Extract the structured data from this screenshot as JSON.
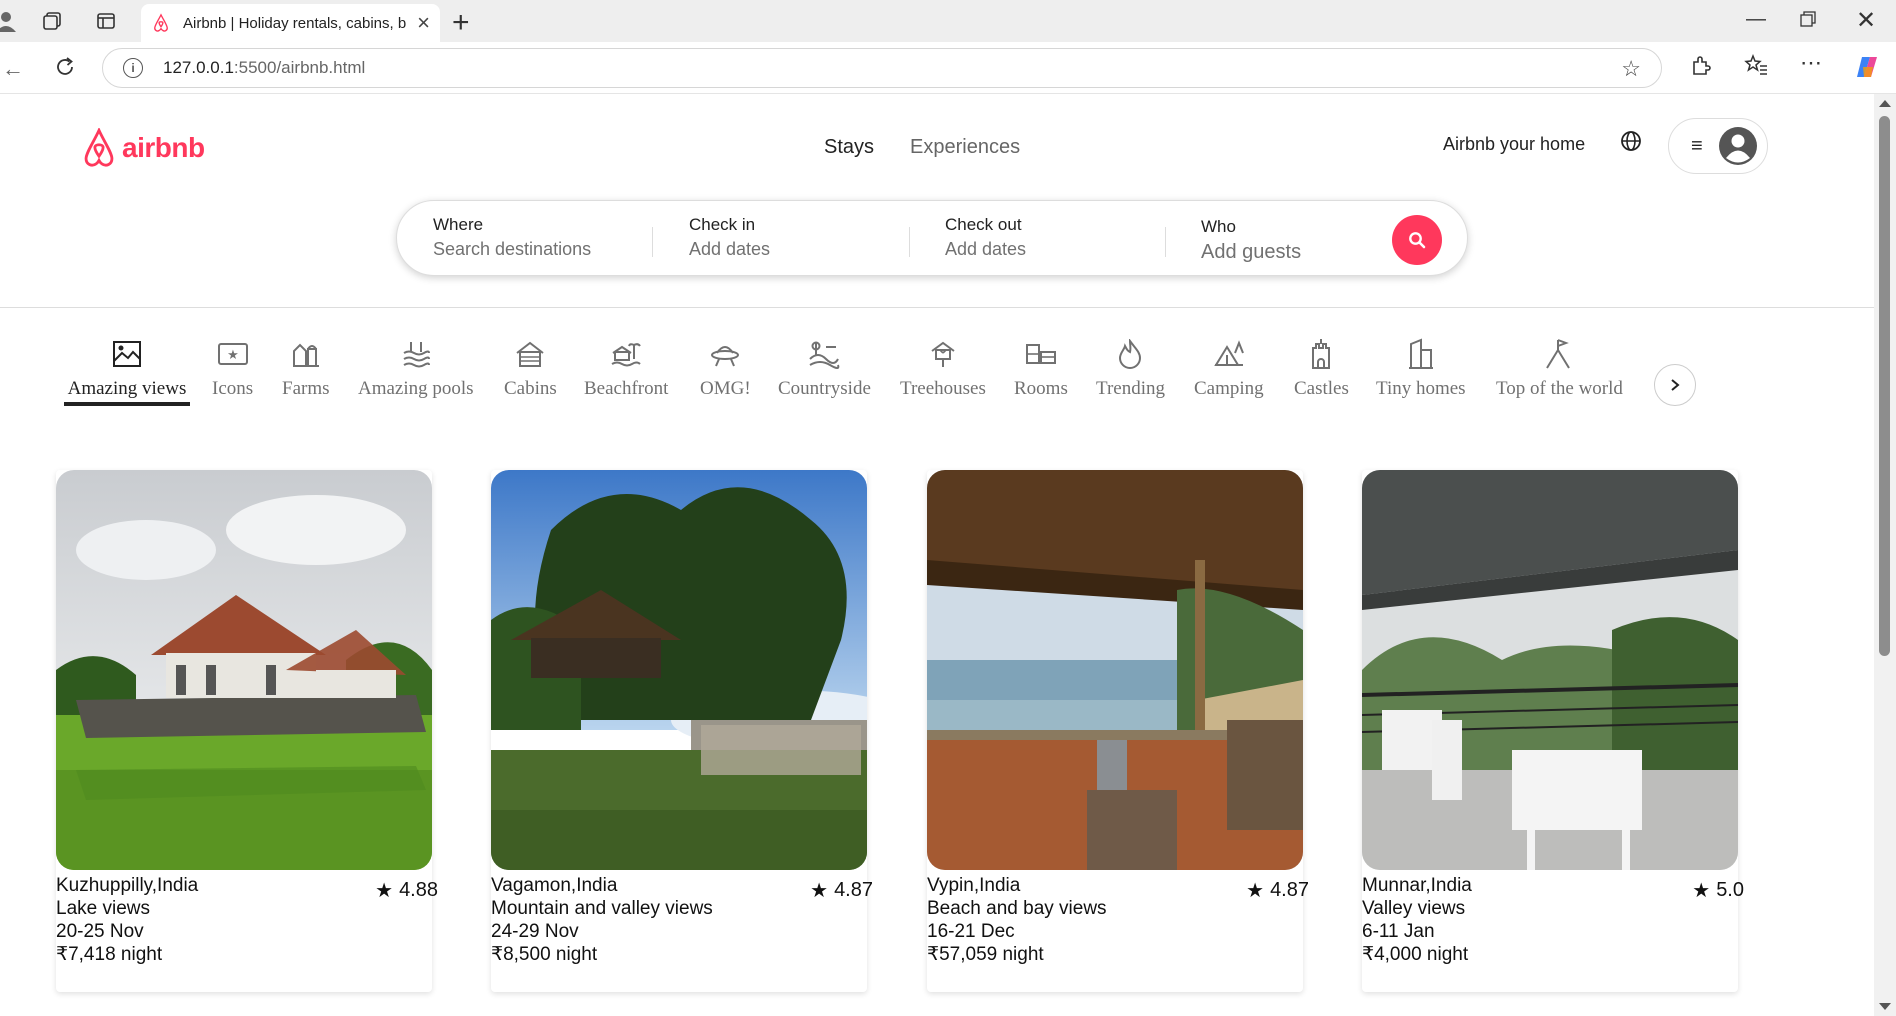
{
  "browser": {
    "tab_title": "Airbnb | Holiday rentals, cabins, b",
    "url_host": "127.0.0.1",
    "url_rest": ":5500/airbnb.html"
  },
  "header": {
    "logo_text": "airbnb",
    "nav": [
      "Stays",
      "Experiences"
    ],
    "host_link": "Airbnb your home"
  },
  "search": {
    "where_label": "Where",
    "where_value": "Search destinations",
    "checkin_label": "Check in",
    "checkin_value": "Add dates",
    "checkout_label": "Check out",
    "checkout_value": "Add dates",
    "who_label": "Who",
    "who_value": "Add guests"
  },
  "categories": [
    {
      "label": "Amazing views",
      "icon": "amazing-views-icon"
    },
    {
      "label": "Icons",
      "icon": "icons-icon"
    },
    {
      "label": "Farms",
      "icon": "farms-icon"
    },
    {
      "label": "Amazing pools",
      "icon": "pools-icon"
    },
    {
      "label": "Cabins",
      "icon": "cabins-icon"
    },
    {
      "label": "Beachfront",
      "icon": "beachfront-icon"
    },
    {
      "label": "OMG!",
      "icon": "omg-icon"
    },
    {
      "label": "Countryside",
      "icon": "countryside-icon"
    },
    {
      "label": "Treehouses",
      "icon": "treehouses-icon"
    },
    {
      "label": "Rooms",
      "icon": "rooms-icon"
    },
    {
      "label": "Trending",
      "icon": "trending-icon"
    },
    {
      "label": "Camping",
      "icon": "camping-icon"
    },
    {
      "label": "Castles",
      "icon": "castles-icon"
    },
    {
      "label": "Tiny homes",
      "icon": "tiny-homes-icon"
    },
    {
      "label": "Top of the world",
      "icon": "top-of-world-icon"
    }
  ],
  "listings": [
    {
      "location": "Kuzhuppilly,India",
      "desc": "Lake views",
      "dates": "20-25 Nov",
      "price": "₹7,418 night",
      "rating": "4.88"
    },
    {
      "location": "Vagamon,India",
      "desc": "Mountain and valley views",
      "dates": "24-29 Nov",
      "price": "₹8,500 night",
      "rating": "4.87"
    },
    {
      "location": "Vypin,India",
      "desc": "Beach and bay views",
      "dates": "16-21 Dec",
      "price": "₹57,059 night",
      "rating": "4.87"
    },
    {
      "location": "Munnar,India",
      "desc": "Valley views",
      "dates": "6-11 Jan",
      "price": "₹4,000 night",
      "rating": "5.0"
    }
  ],
  "colors": {
    "brand": "#ff385c"
  }
}
